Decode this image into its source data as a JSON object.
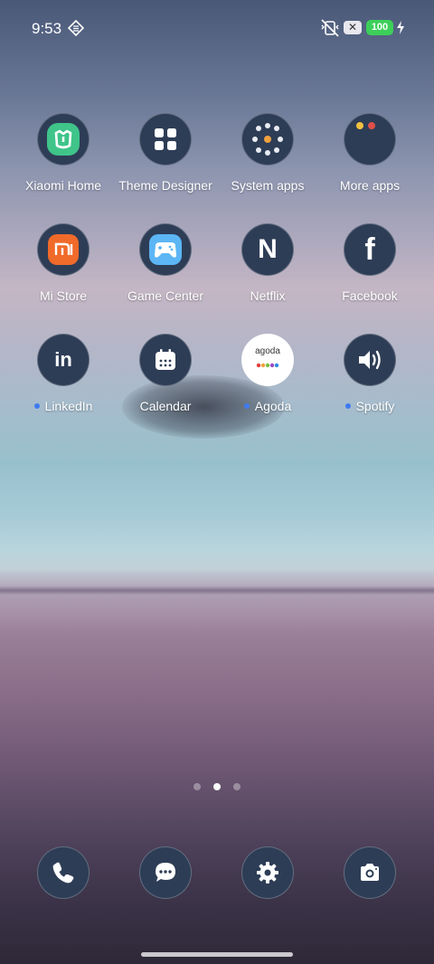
{
  "status": {
    "time": "9:53",
    "notification_badge": "✕",
    "battery": "100"
  },
  "apps": [
    {
      "label": "Xiaomi Home",
      "icon": "xiaomi-home-icon",
      "dot": false
    },
    {
      "label": "Theme Designer",
      "icon": "theme-designer-icon",
      "dot": false
    },
    {
      "label": "System apps",
      "icon": "folder-system-apps-icon",
      "dot": false
    },
    {
      "label": "More apps",
      "icon": "folder-more-apps-icon",
      "dot": false
    },
    {
      "label": "Mi Store",
      "icon": "mi-store-icon",
      "dot": false
    },
    {
      "label": "Game Center",
      "icon": "game-center-icon",
      "dot": false
    },
    {
      "label": "Netflix",
      "icon": "netflix-icon",
      "dot": false
    },
    {
      "label": "Facebook",
      "icon": "facebook-icon",
      "dot": false
    },
    {
      "label": "LinkedIn",
      "icon": "linkedin-icon",
      "dot": true
    },
    {
      "label": "Calendar",
      "icon": "calendar-icon",
      "dot": false
    },
    {
      "label": "Agoda",
      "icon": "agoda-icon",
      "dot": true
    },
    {
      "label": "Spotify",
      "icon": "spotify-icon",
      "dot": true
    }
  ],
  "app_icon_text": {
    "netflix": "N",
    "facebook": "f",
    "linkedin": "in",
    "mi_store": "mi",
    "agoda": "agoda"
  },
  "dock": [
    "phone-icon",
    "messages-icon",
    "settings-icon",
    "camera-icon"
  ],
  "pages": {
    "count": 3,
    "current": 2
  },
  "colors": {
    "icon_bg": "#2e3d56",
    "notify_dot": "#3f7bf0",
    "battery": "#3ccf5a"
  }
}
